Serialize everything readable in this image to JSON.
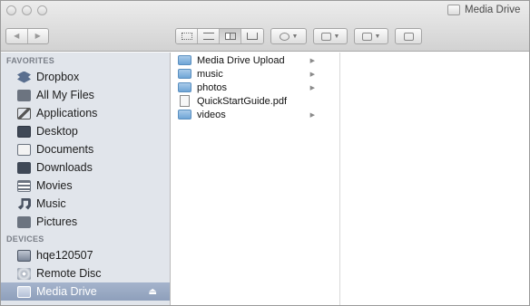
{
  "window": {
    "title": "Media Drive"
  },
  "toolbar": {
    "nav_back": "◀",
    "nav_forward": "▶",
    "views": [
      "icon-view",
      "list-view",
      "column-view",
      "coverflow-view"
    ],
    "active_view": "column-view",
    "action_caret": "▼",
    "dropbox_caret": "▼",
    "arrange_caret": "▼"
  },
  "sidebar": {
    "favorites_header": "FAVORITES",
    "favorites": [
      {
        "label": "Dropbox",
        "icon": "dropbox-icon"
      },
      {
        "label": "All My Files",
        "icon": "all-files-icon"
      },
      {
        "label": "Applications",
        "icon": "applications-icon"
      },
      {
        "label": "Desktop",
        "icon": "desktop-icon"
      },
      {
        "label": "Documents",
        "icon": "documents-icon"
      },
      {
        "label": "Downloads",
        "icon": "downloads-icon"
      },
      {
        "label": "Movies",
        "icon": "movies-icon"
      },
      {
        "label": "Music",
        "icon": "music-icon"
      },
      {
        "label": "Pictures",
        "icon": "pictures-icon"
      }
    ],
    "devices_header": "DEVICES",
    "devices": [
      {
        "label": "hqe120507",
        "icon": "computer-icon"
      },
      {
        "label": "Remote Disc",
        "icon": "disc-icon"
      },
      {
        "label": "Media Drive",
        "icon": "drive-icon",
        "selected": true,
        "eject": "⏏"
      }
    ]
  },
  "column": {
    "items": [
      {
        "name": "Media Drive Upload",
        "type": "folder",
        "has_children": true
      },
      {
        "name": "music",
        "type": "folder",
        "has_children": true
      },
      {
        "name": "photos",
        "type": "folder",
        "has_children": true
      },
      {
        "name": "QuickStartGuide.pdf",
        "type": "pdf",
        "has_children": false
      },
      {
        "name": "videos",
        "type": "folder",
        "has_children": true
      }
    ],
    "chevron": "▶"
  },
  "colors": {
    "sidebar_bg": "#e1e5eb",
    "selection": "#97a8c3",
    "folder_blue": "#6fa5d6"
  }
}
